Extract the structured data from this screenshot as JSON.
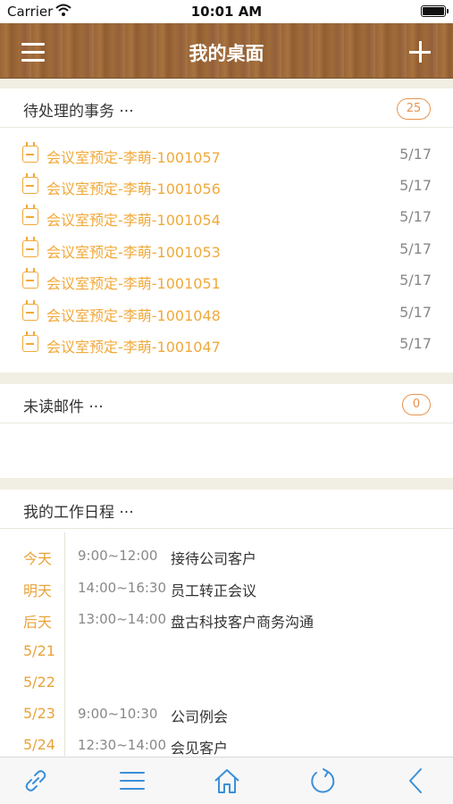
{
  "status_bar": {
    "carrier": "Carrier",
    "time": "10:01 AM"
  },
  "navbar": {
    "title": "我的桌面"
  },
  "pending": {
    "title": "待处理的事务 ···",
    "count": "25",
    "items": [
      {
        "title": "会议室预定-李萌-1001057",
        "date": "5/17"
      },
      {
        "title": "会议室预定-李萌-1001056",
        "date": "5/17"
      },
      {
        "title": "会议室预定-李萌-1001054",
        "date": "5/17"
      },
      {
        "title": "会议室预定-李萌-1001053",
        "date": "5/17"
      },
      {
        "title": "会议室预定-李萌-1001051",
        "date": "5/17"
      },
      {
        "title": "会议室预定-李萌-1001048",
        "date": "5/17"
      },
      {
        "title": "会议室预定-李萌-1001047",
        "date": "5/17"
      }
    ]
  },
  "mail": {
    "title": "未读邮件 ···",
    "count": "0"
  },
  "schedule": {
    "title": "我的工作日程 ···",
    "rows": [
      {
        "day": "今天",
        "time": "9:00~12:00",
        "event": "接待公司客户"
      },
      {
        "day": "明天",
        "time": "14:00~16:30",
        "event": "员工转正会议"
      },
      {
        "day": "后天",
        "time": "13:00~14:00",
        "event": "盘古科技客户商务沟通"
      },
      {
        "day": "5/21",
        "time": "",
        "event": ""
      },
      {
        "day": "5/22",
        "time": "",
        "event": ""
      },
      {
        "day": "5/23",
        "time": "9:00~10:30",
        "event": "公司例会"
      },
      {
        "day": "5/24",
        "time": "12:30~14:00",
        "event": "会见客户"
      }
    ]
  },
  "tab_bar": {
    "items": [
      {
        "icon": "link-icon"
      },
      {
        "icon": "list-icon"
      },
      {
        "icon": "home-icon"
      },
      {
        "icon": "refresh-icon"
      },
      {
        "icon": "back-icon"
      }
    ]
  },
  "colors": {
    "accent": "#f0a93a",
    "tab_icon": "#3b8fd9",
    "nav_wood": "#9a6638"
  }
}
